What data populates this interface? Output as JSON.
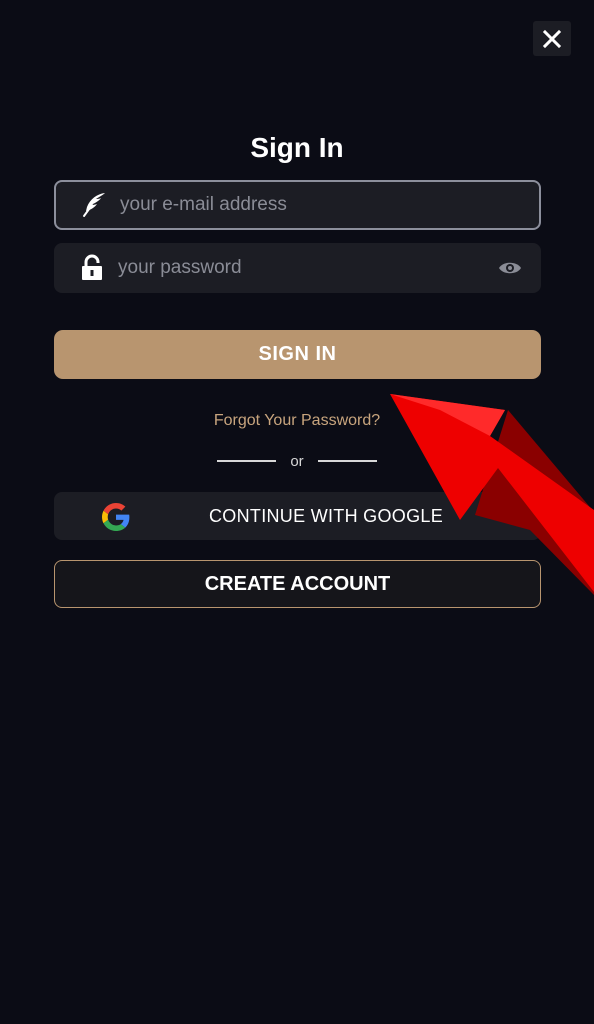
{
  "dialog": {
    "title": "Sign In"
  },
  "email": {
    "placeholder": "your e-mail address",
    "value": "",
    "icon": "feather-icon"
  },
  "password": {
    "placeholder": "your password",
    "value": "",
    "icon": "lock-icon",
    "toggle_icon": "eye-icon"
  },
  "buttons": {
    "sign_in": "SIGN IN",
    "forgot": "Forgot Your Password?",
    "divider_text": "or",
    "google": "CONTINUE WITH GOOGLE",
    "create_account": "CREATE ACCOUNT"
  },
  "colors": {
    "background": "#0b0c15",
    "field_bg": "#1c1d24",
    "accent": "#b8956f",
    "link": "#c8a57e",
    "annotation_arrow": "#e60000"
  }
}
